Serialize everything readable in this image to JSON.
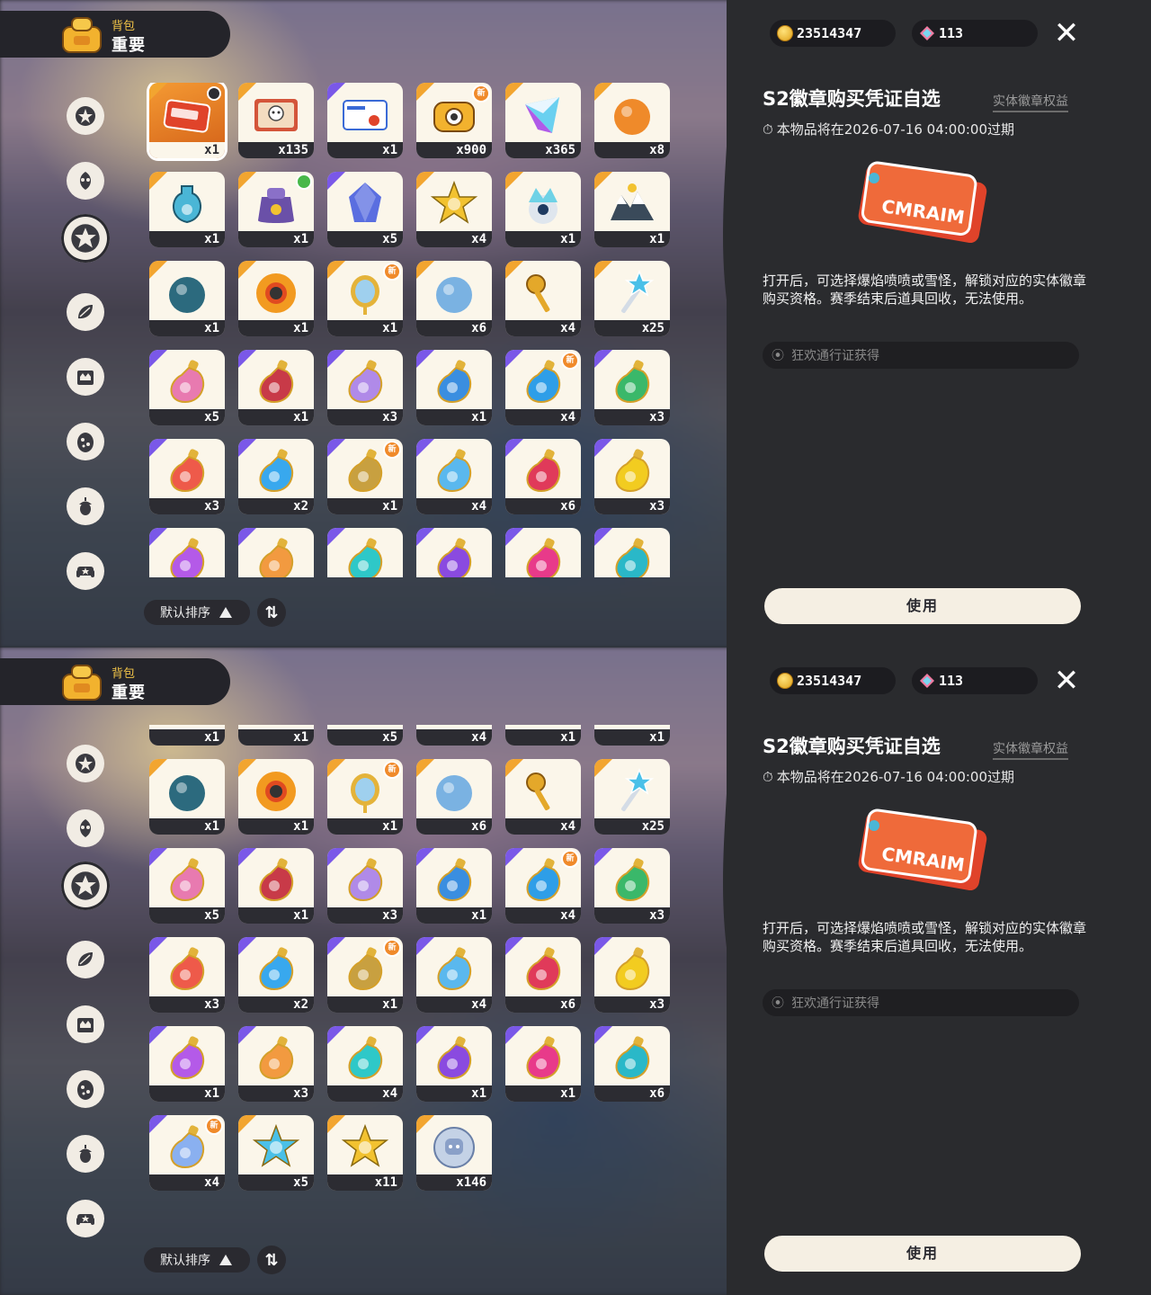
{
  "header": {
    "bag_label": "背包",
    "tab_title": "重要"
  },
  "currency": {
    "coins": "23514347",
    "gems": "113"
  },
  "detail": {
    "title": "S2徽章购买凭证自选",
    "tag": "实体徽章权益",
    "expiry": "本物品将在2026-07-16 04:00:00过期",
    "description": "打开后，可选择爆焰喷喷或雪怪，解锁对应的实体徽章购买资格。赛季结束后道具回收，无法使用。",
    "source": "狂欢通行证获得",
    "use_label": "使用",
    "art_text": "CMRAIM"
  },
  "sort": {
    "label": "默认排序"
  },
  "categories": [
    {
      "icon": "star-badge-icon"
    },
    {
      "icon": "leaf-spirit-icon"
    },
    {
      "icon": "special-star-icon"
    },
    {
      "icon": "plant-leaves-icon"
    },
    {
      "icon": "card-crown-icon"
    },
    {
      "icon": "egg-icon"
    },
    {
      "icon": "acorn-icon"
    },
    {
      "icon": "sofa-icon"
    }
  ],
  "new_badge": "新",
  "items": [
    {
      "id": "s2-voucher",
      "qty": "x1",
      "rarity": "gold",
      "art": "ticket",
      "badge": "clock"
    },
    {
      "id": "rabbit-card",
      "qty": "x135",
      "rarity": "gold",
      "art": "card"
    },
    {
      "id": "ticket-pass",
      "qty": "x1",
      "rarity": "purple",
      "art": "paper"
    },
    {
      "id": "camera-star",
      "qty": "x900",
      "rarity": "gold",
      "art": "camera",
      "badge": "new"
    },
    {
      "id": "prism-crystal",
      "qty": "x365",
      "rarity": "gold",
      "art": "prism"
    },
    {
      "id": "orange-orb",
      "qty": "x8",
      "rarity": "gold",
      "art": "orb",
      "color": "#ef8a2a"
    },
    {
      "id": "blue-vase",
      "qty": "x1",
      "rarity": "gold",
      "art": "vase",
      "color": "#4ab6d6"
    },
    {
      "id": "purple-bag",
      "qty": "x1",
      "rarity": "gold",
      "art": "bag",
      "color": "#6a50a8",
      "badge": "green"
    },
    {
      "id": "blue-gem",
      "qty": "x5",
      "rarity": "purple",
      "art": "gem",
      "color": "#5a6ee0"
    },
    {
      "id": "gold-star",
      "qty": "x4",
      "rarity": "gold",
      "art": "star",
      "color": "#f2c230"
    },
    {
      "id": "crystal-crown",
      "qty": "x1",
      "rarity": "gold",
      "art": "crown",
      "color": "#6fd2e6"
    },
    {
      "id": "mountain-crown",
      "qty": "x1",
      "rarity": "gold",
      "art": "mountain",
      "color": "#8fb0c8"
    },
    {
      "id": "leaf-shell",
      "qty": "x1",
      "rarity": "gold",
      "art": "orb",
      "color": "#2c6a7e"
    },
    {
      "id": "flame-flower",
      "qty": "x1",
      "rarity": "gold",
      "art": "flower",
      "color": "#f29a20"
    },
    {
      "id": "gold-mirror",
      "qty": "x1",
      "rarity": "gold",
      "art": "mirror",
      "color": "#9fd0ee",
      "badge": "new"
    },
    {
      "id": "blue-shell",
      "qty": "x6",
      "rarity": "gold",
      "art": "orb",
      "color": "#7ab2e2"
    },
    {
      "id": "gold-key",
      "qty": "x4",
      "rarity": "gold",
      "art": "key",
      "color": "#e4a82a"
    },
    {
      "id": "star-wand",
      "qty": "x25",
      "rarity": "gold",
      "art": "wand",
      "color": "#9cb0c2"
    },
    {
      "id": "rainbow-potion",
      "qty": "x5",
      "rarity": "purple",
      "art": "potion",
      "color": "#e87ab0"
    },
    {
      "id": "red-potion",
      "qty": "x1",
      "rarity": "purple",
      "art": "potion",
      "color": "#c83a48"
    },
    {
      "id": "crystal-potion",
      "qty": "x3",
      "rarity": "purple",
      "art": "potion",
      "color": "#b08ae8"
    },
    {
      "id": "blue-flask",
      "qty": "x1",
      "rarity": "purple",
      "art": "potion",
      "color": "#3a8ee0"
    },
    {
      "id": "blue-round-potion",
      "qty": "x4",
      "rarity": "purple",
      "art": "potion",
      "color": "#2e9ee8",
      "badge": "new"
    },
    {
      "id": "green-potion",
      "qty": "x3",
      "rarity": "purple",
      "art": "potion",
      "color": "#3ab86a"
    },
    {
      "id": "coral-potion",
      "qty": "x3",
      "rarity": "purple",
      "art": "potion",
      "color": "#ee5a4a"
    },
    {
      "id": "sky-potion",
      "qty": "x2",
      "rarity": "purple",
      "art": "potion",
      "color": "#38a8ee"
    },
    {
      "id": "sand-potion",
      "qty": "x1",
      "rarity": "purple",
      "art": "potion",
      "color": "#c8a040",
      "badge": "new"
    },
    {
      "id": "ice-potion",
      "qty": "x4",
      "rarity": "purple",
      "art": "potion",
      "color": "#5ab8ee"
    },
    {
      "id": "crimson-potion",
      "qty": "x6",
      "rarity": "purple",
      "art": "potion",
      "color": "#e03a5a"
    },
    {
      "id": "yellow-potion",
      "qty": "x3",
      "rarity": "purple",
      "art": "potion",
      "color": "#f2cc20"
    },
    {
      "id": "violet-potion",
      "qty": "x1",
      "rarity": "purple",
      "art": "potion",
      "color": "#b45ae8"
    },
    {
      "id": "amber-potion",
      "qty": "x3",
      "rarity": "purple",
      "art": "potion",
      "color": "#f29a40"
    },
    {
      "id": "teal-potion",
      "qty": "x4",
      "rarity": "purple",
      "art": "potion",
      "color": "#2ec8c8"
    },
    {
      "id": "plum-potion",
      "qty": "x1",
      "rarity": "purple",
      "art": "potion",
      "color": "#8a4ae0"
    },
    {
      "id": "rose-potion",
      "qty": "x1",
      "rarity": "purple",
      "art": "potion",
      "color": "#e83a8a"
    },
    {
      "id": "cyan-potion",
      "qty": "x6",
      "rarity": "purple",
      "art": "potion",
      "color": "#2ab8c8"
    },
    {
      "id": "swirl-potion",
      "qty": "x4",
      "rarity": "purple",
      "art": "potion",
      "color": "#8ab0f0",
      "badge": "new"
    },
    {
      "id": "blue-star-coin",
      "qty": "x5",
      "rarity": "gold",
      "art": "star",
      "color": "#4ac0e8"
    },
    {
      "id": "gold-star-coin",
      "qty": "x11",
      "rarity": "gold",
      "art": "star",
      "color": "#f2c230"
    },
    {
      "id": "silver-coin",
      "qty": "x146",
      "rarity": "gold",
      "art": "coin",
      "color": "#8aa0c8"
    }
  ]
}
